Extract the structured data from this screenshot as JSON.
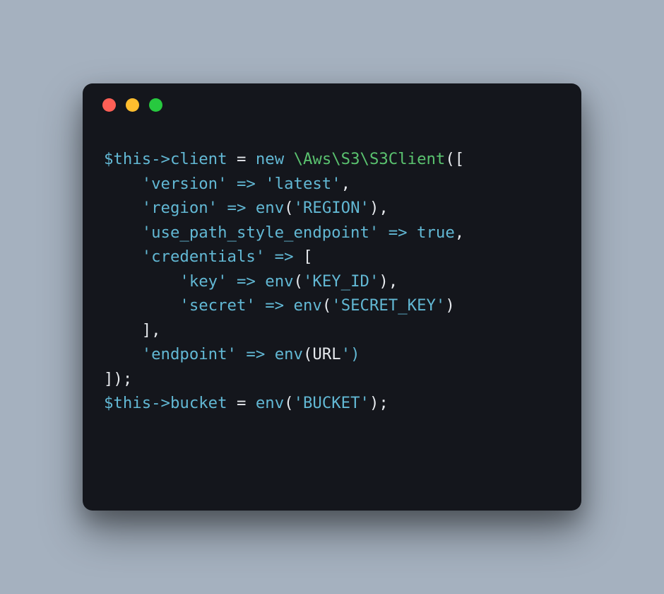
{
  "window": {
    "traffic_lights": {
      "red": "close",
      "yellow": "minimize",
      "green": "maximize"
    }
  },
  "code": {
    "lines": [
      {
        "indent": "",
        "tokens": [
          {
            "t": "$this",
            "c": "tok-var"
          },
          {
            "t": "->",
            "c": "tok-op"
          },
          {
            "t": "client",
            "c": "tok-prop"
          },
          {
            "t": " ",
            "c": "tok-punct"
          },
          {
            "t": "=",
            "c": "tok-punct"
          },
          {
            "t": " ",
            "c": "tok-punct"
          },
          {
            "t": "new",
            "c": "tok-keyword"
          },
          {
            "t": " ",
            "c": "tok-punct"
          },
          {
            "t": "\\Aws\\S3\\S3Client",
            "c": "tok-ns"
          },
          {
            "t": "([",
            "c": "tok-punct"
          }
        ]
      },
      {
        "indent": "    ",
        "tokens": [
          {
            "t": "'version'",
            "c": "tok-string"
          },
          {
            "t": " ",
            "c": "tok-punct"
          },
          {
            "t": "=>",
            "c": "tok-op"
          },
          {
            "t": " ",
            "c": "tok-punct"
          },
          {
            "t": "'latest'",
            "c": "tok-string"
          },
          {
            "t": ",",
            "c": "tok-punct"
          }
        ]
      },
      {
        "indent": "    ",
        "tokens": [
          {
            "t": "'region'",
            "c": "tok-string"
          },
          {
            "t": " ",
            "c": "tok-punct"
          },
          {
            "t": "=>",
            "c": "tok-op"
          },
          {
            "t": " ",
            "c": "tok-punct"
          },
          {
            "t": "env",
            "c": "tok-func"
          },
          {
            "t": "(",
            "c": "tok-punct"
          },
          {
            "t": "'REGION'",
            "c": "tok-string"
          },
          {
            "t": "),",
            "c": "tok-punct"
          }
        ]
      },
      {
        "indent": "    ",
        "tokens": [
          {
            "t": "'use_path_style_endpoint'",
            "c": "tok-string"
          },
          {
            "t": " ",
            "c": "tok-punct"
          },
          {
            "t": "=>",
            "c": "tok-op"
          },
          {
            "t": " ",
            "c": "tok-punct"
          },
          {
            "t": "true",
            "c": "tok-bool"
          },
          {
            "t": ",",
            "c": "tok-punct"
          }
        ]
      },
      {
        "indent": "    ",
        "tokens": [
          {
            "t": "'credentials'",
            "c": "tok-string"
          },
          {
            "t": " ",
            "c": "tok-punct"
          },
          {
            "t": "=>",
            "c": "tok-op"
          },
          {
            "t": " [",
            "c": "tok-punct"
          }
        ]
      },
      {
        "indent": "        ",
        "tokens": [
          {
            "t": "'key'",
            "c": "tok-string"
          },
          {
            "t": " ",
            "c": "tok-punct"
          },
          {
            "t": "=>",
            "c": "tok-op"
          },
          {
            "t": " ",
            "c": "tok-punct"
          },
          {
            "t": "env",
            "c": "tok-func"
          },
          {
            "t": "(",
            "c": "tok-punct"
          },
          {
            "t": "'KEY_ID'",
            "c": "tok-string"
          },
          {
            "t": "),",
            "c": "tok-punct"
          }
        ]
      },
      {
        "indent": "        ",
        "tokens": [
          {
            "t": "'secret'",
            "c": "tok-string"
          },
          {
            "t": " ",
            "c": "tok-punct"
          },
          {
            "t": "=>",
            "c": "tok-op"
          },
          {
            "t": " ",
            "c": "tok-punct"
          },
          {
            "t": "env",
            "c": "tok-func"
          },
          {
            "t": "(",
            "c": "tok-punct"
          },
          {
            "t": "'SECRET_KEY'",
            "c": "tok-string"
          },
          {
            "t": ")",
            "c": "tok-punct"
          }
        ]
      },
      {
        "indent": "    ",
        "tokens": [
          {
            "t": "],",
            "c": "tok-punct"
          }
        ]
      },
      {
        "indent": "    ",
        "tokens": [
          {
            "t": "'endpoint'",
            "c": "tok-string"
          },
          {
            "t": " ",
            "c": "tok-punct"
          },
          {
            "t": "=>",
            "c": "tok-op"
          },
          {
            "t": " ",
            "c": "tok-punct"
          },
          {
            "t": "env",
            "c": "tok-func"
          },
          {
            "t": "(",
            "c": "tok-punct"
          },
          {
            "t": "URL",
            "c": "tok-const"
          },
          {
            "t": "')",
            "c": "tok-string"
          }
        ]
      },
      {
        "indent": "",
        "tokens": [
          {
            "t": "]);",
            "c": "tok-punct"
          }
        ]
      },
      {
        "indent": "",
        "tokens": [
          {
            "t": "$this",
            "c": "tok-var"
          },
          {
            "t": "->",
            "c": "tok-op"
          },
          {
            "t": "bucket",
            "c": "tok-prop"
          },
          {
            "t": " ",
            "c": "tok-punct"
          },
          {
            "t": "=",
            "c": "tok-punct"
          },
          {
            "t": " ",
            "c": "tok-punct"
          },
          {
            "t": "env",
            "c": "tok-func"
          },
          {
            "t": "(",
            "c": "tok-punct"
          },
          {
            "t": "'BUCKET'",
            "c": "tok-string"
          },
          {
            "t": ");",
            "c": "tok-punct"
          }
        ]
      }
    ]
  }
}
